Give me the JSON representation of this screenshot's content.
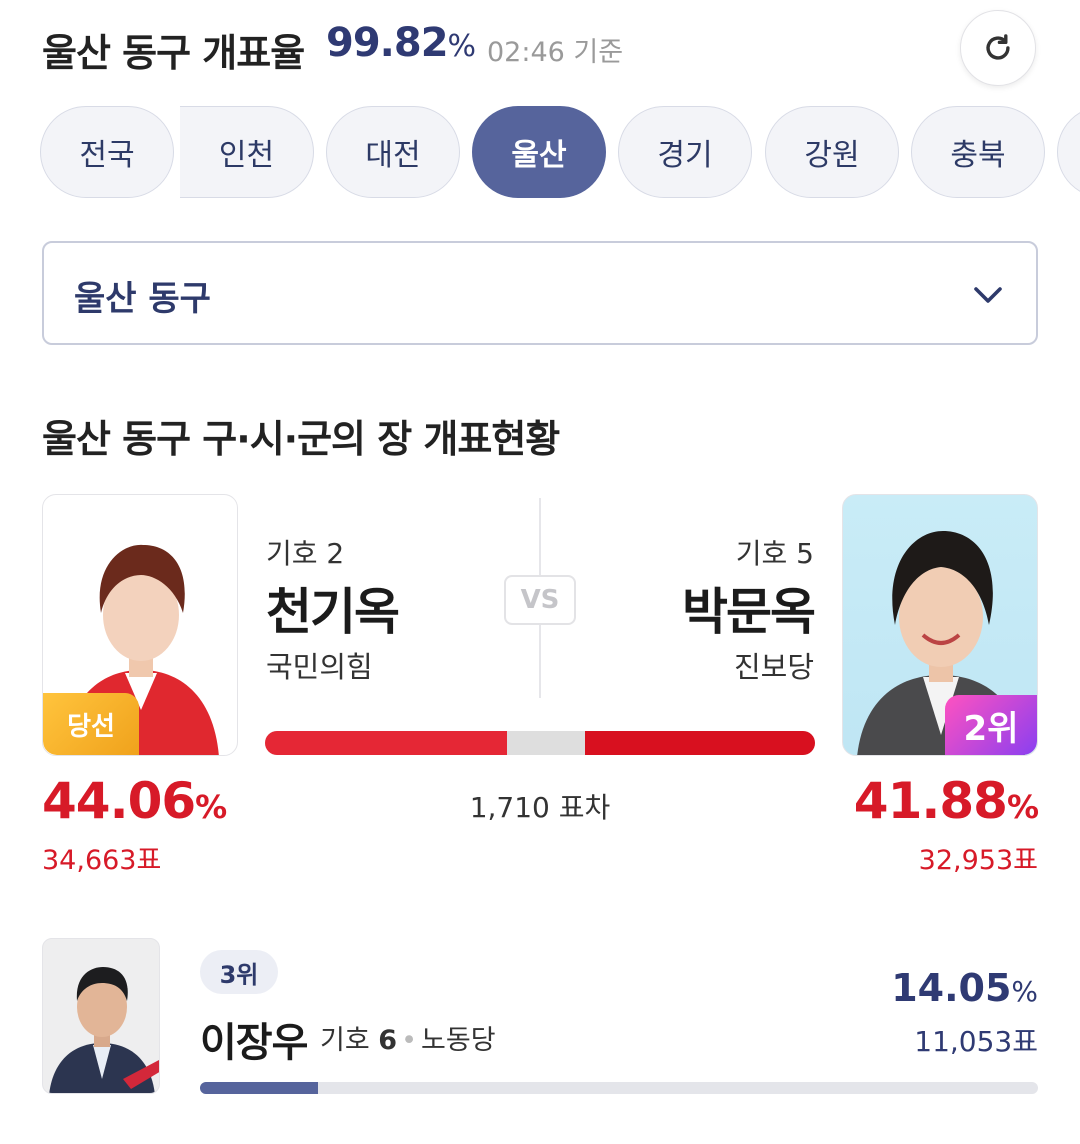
{
  "header": {
    "title": "울산 동구 개표율",
    "rate_value": "99.82",
    "rate_unit": "%",
    "time": "02:46 기준"
  },
  "tabs": [
    {
      "label": "전국",
      "active": false
    },
    {
      "label": "인천",
      "active": false
    },
    {
      "label": "대전",
      "active": false
    },
    {
      "label": "울산",
      "active": true
    },
    {
      "label": "경기",
      "active": false
    },
    {
      "label": "강원",
      "active": false
    },
    {
      "label": "충북",
      "active": false
    }
  ],
  "district_select": {
    "value": "울산 동구"
  },
  "section_title": "울산 동구 구·시·군의 장 개표현황",
  "candidates": {
    "first": {
      "number": "기호 2",
      "name": "천기옥",
      "party": "국민의힘",
      "badge": "당선",
      "pct_value": "44.06",
      "pct_unit": "%",
      "votes": "34,663표",
      "share": 44.06
    },
    "second": {
      "number": "기호 5",
      "name": "박문옥",
      "party": "진보당",
      "badge": "2위",
      "pct_value": "41.88",
      "pct_unit": "%",
      "votes": "32,953표",
      "share": 41.88
    },
    "vs_label": "VS",
    "difference": "1,710 표차"
  },
  "third": {
    "rank": "3위",
    "name": "이장우",
    "number_prefix": "기호",
    "number": "6",
    "party": "노동당",
    "pct_value": "14.05",
    "pct_unit": "%",
    "votes": "11,053표",
    "share": 14.05
  },
  "colors": {
    "navy": "#2f3a73",
    "active_tab": "#56649c",
    "red": "#d71a28",
    "win_badge": "#f5b12a",
    "rank_badge": "#c047e8"
  }
}
